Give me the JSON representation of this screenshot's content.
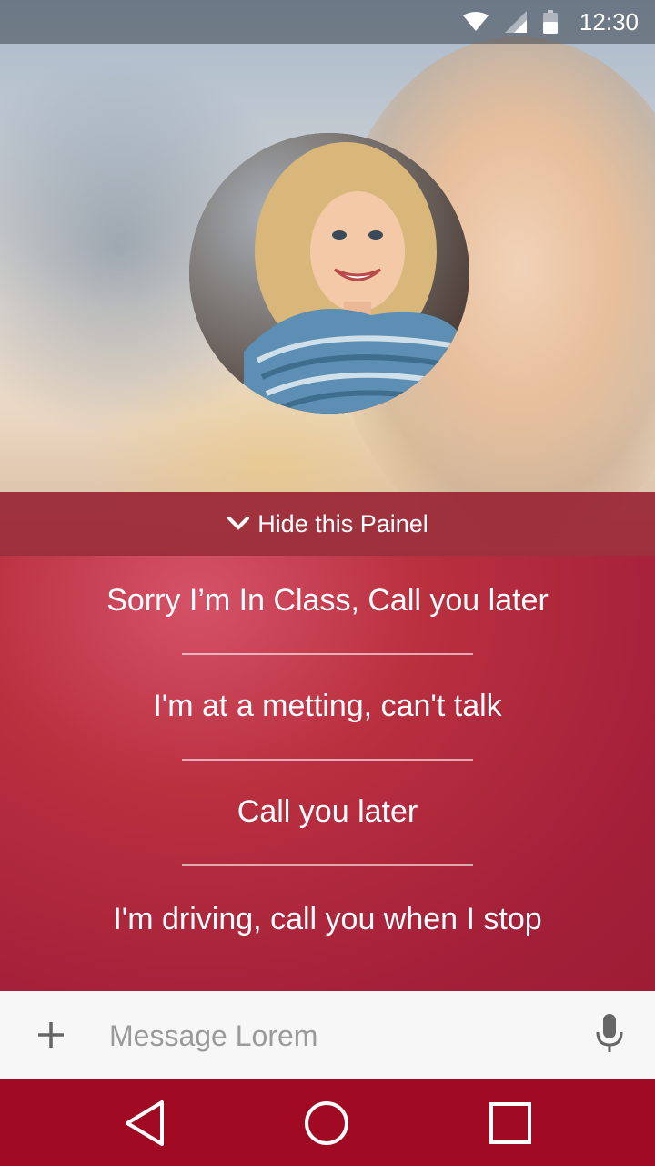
{
  "status_bar": {
    "time": "12:30",
    "icons": [
      "wifi-icon",
      "signal-icon",
      "battery-icon"
    ]
  },
  "contact": {
    "avatar_icon": "contact-photo"
  },
  "panel": {
    "hide_label": "Hide this Painel",
    "hide_icon": "chevron-down-icon"
  },
  "quick_replies": [
    "Sorry I’m In Class, Call you later",
    "I'm at a metting, can't talk",
    "Call you later",
    "I'm driving, call you when I stop"
  ],
  "composer": {
    "placeholder": "Message Lorem",
    "add_icon": "plus-icon",
    "mic_icon": "microphone-icon"
  },
  "nav_bar": {
    "icons": [
      "back-icon",
      "home-icon",
      "recents-icon"
    ],
    "color": "#a00b23"
  },
  "colors": {
    "accent": "#b5283c",
    "panel": "#96202f"
  }
}
